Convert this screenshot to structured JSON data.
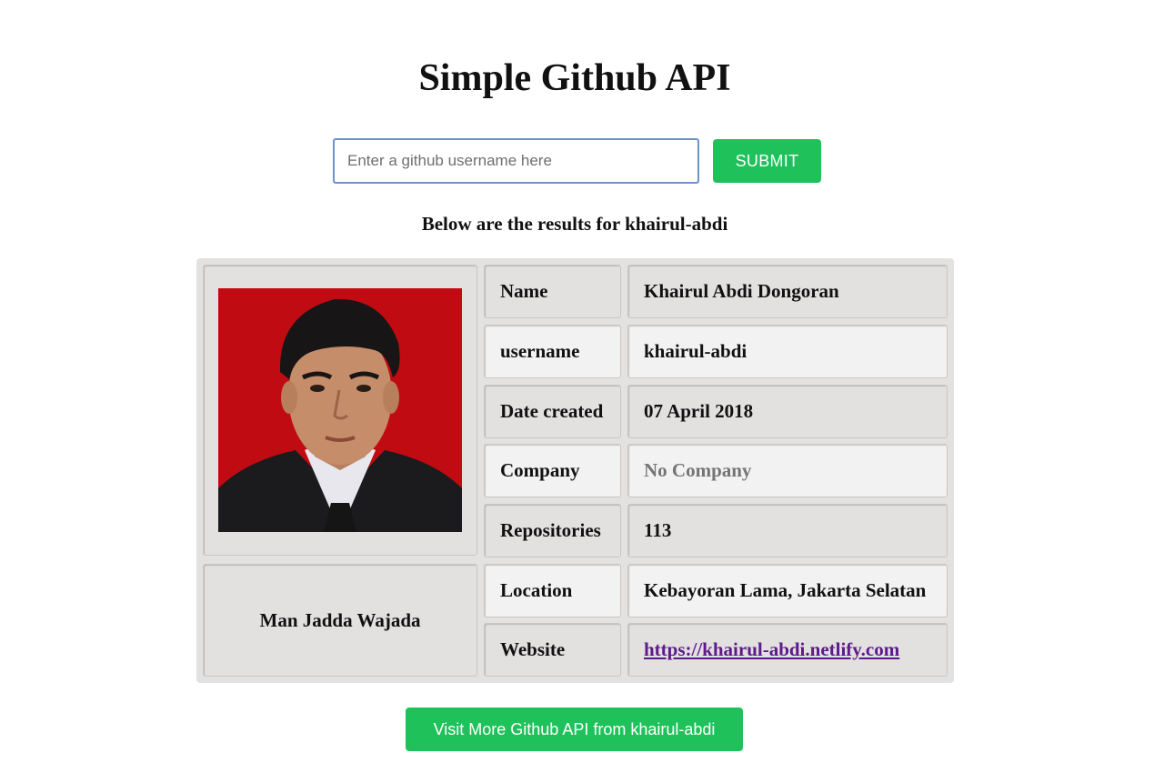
{
  "header": {
    "title": "Simple Github API"
  },
  "search": {
    "placeholder": "Enter a github username here",
    "value": "",
    "submit_label": "SUBMIT"
  },
  "results": {
    "heading": "Below are the results for khairul-abdi",
    "motto": "Man Jadda Wajada",
    "rows": [
      {
        "label": "Name",
        "value": "Khairul Abdi Dongoran"
      },
      {
        "label": "username",
        "value": "khairul-abdi"
      },
      {
        "label": "Date created",
        "value": "07 April 2018"
      },
      {
        "label": "Company",
        "value": "No Company"
      },
      {
        "label": "Repositories",
        "value": "113"
      },
      {
        "label": "Location",
        "value": "Kebayoran Lama, Jakarta Selatan"
      },
      {
        "label": "Website",
        "value": "https://khairul-abdi.netlify.com"
      }
    ]
  },
  "footer": {
    "visit_label": "Visit More Github API from khairul-abdi"
  },
  "colors": {
    "accent_green": "#1fc15a",
    "card_background": "#e4e1e1",
    "link_color": "#5d1a8b",
    "photo_background": "#c10b12"
  }
}
